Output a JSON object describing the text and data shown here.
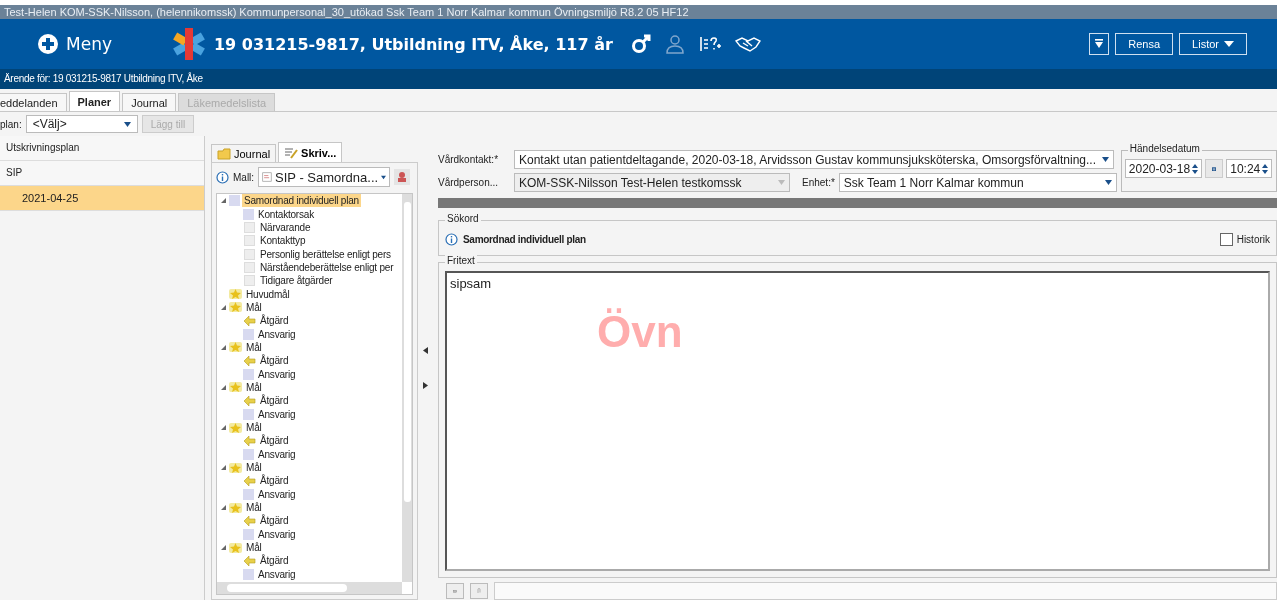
{
  "title_bar": {
    "title": "Test-Helen  KOM-SSK-Nilsson, (helennikomssk) Kommunpersonal_30_utökad Ssk Team 1 Norr Kalmar kommun Övningsmiljö R8.2 05 HF12"
  },
  "header": {
    "menu_label": "Meny",
    "patient": "19 031215-9817,  Utbildning ITV, Åke,  117 år",
    "buttons": [
      {
        "label": "Rensa",
        "kind": "plain"
      },
      {
        "label": "Listor",
        "kind": "dropdown"
      }
    ]
  },
  "case_bar": {
    "text": "Ärende för: 19 031215-9817 Utbildning ITV, Åke"
  },
  "tabs": [
    {
      "label": "eddelanden",
      "selected": false,
      "disabled": false
    },
    {
      "label": "Planer",
      "selected": true,
      "disabled": false
    },
    {
      "label": "Journal",
      "selected": false,
      "disabled": false
    },
    {
      "label": "Läkemedelslista",
      "selected": false,
      "disabled": true
    }
  ],
  "plan_toolbar": {
    "label": "plan:",
    "select": "<Välj>",
    "button": {
      "label": "Lägg till",
      "disabled": true
    }
  },
  "plan_list": [
    {
      "label": "Utskrivningsplan",
      "selected": false
    },
    {
      "label": "SIP",
      "selected": false,
      "children": [
        {
          "label": "2021-04-25",
          "selected": true
        }
      ]
    }
  ],
  "template_tabs": [
    {
      "label": "Journal",
      "selected": false
    },
    {
      "label": "Skriv...",
      "selected": true
    }
  ],
  "template": {
    "label": "Mall:",
    "value": "SIP - Samordna..."
  },
  "tree": [
    {
      "label": "Samordnad individuell plan",
      "kind": "section",
      "expanded": true,
      "selected": true,
      "children": [
        {
          "label": "Kontaktorsak",
          "kind": "section",
          "selected": false
        },
        {
          "label": "Närvarande",
          "kind": "field",
          "selected": false
        },
        {
          "label": "Kontakttyp",
          "kind": "field",
          "selected": false
        },
        {
          "label": "Personlig berättelse enligt pers",
          "kind": "field",
          "selected": false
        },
        {
          "label": "Närståendeberättelse enligt per",
          "kind": "field",
          "selected": false
        },
        {
          "label": "Tidigare åtgärder",
          "kind": "field",
          "selected": false
        }
      ]
    },
    {
      "label": "Huvudmål",
      "kind": "goal",
      "selected": false
    },
    {
      "label": "Mål",
      "kind": "goal",
      "expanded": true,
      "selected": false,
      "children": [
        {
          "label": "Åtgärd",
          "kind": "action",
          "selected": false
        },
        {
          "label": "Ansvarig",
          "kind": "section",
          "selected": false
        }
      ]
    },
    {
      "label": "Mål",
      "kind": "goal",
      "expanded": true,
      "selected": false,
      "children": [
        {
          "label": "Åtgärd",
          "kind": "action",
          "selected": false
        },
        {
          "label": "Ansvarig",
          "kind": "section",
          "selected": false
        }
      ]
    },
    {
      "label": "Mål",
      "kind": "goal",
      "expanded": true,
      "selected": false,
      "children": [
        {
          "label": "Åtgärd",
          "kind": "action",
          "selected": false
        },
        {
          "label": "Ansvarig",
          "kind": "section",
          "selected": false
        }
      ]
    },
    {
      "label": "Mål",
      "kind": "goal",
      "expanded": true,
      "selected": false,
      "children": [
        {
          "label": "Åtgärd",
          "kind": "action",
          "selected": false
        },
        {
          "label": "Ansvarig",
          "kind": "section",
          "selected": false
        }
      ]
    },
    {
      "label": "Mål",
      "kind": "goal",
      "expanded": true,
      "selected": false,
      "children": [
        {
          "label": "Åtgärd",
          "kind": "action",
          "selected": false
        },
        {
          "label": "Ansvarig",
          "kind": "section",
          "selected": false
        }
      ]
    },
    {
      "label": "Mål",
      "kind": "goal",
      "expanded": true,
      "selected": false,
      "children": [
        {
          "label": "Åtgärd",
          "kind": "action",
          "selected": false
        },
        {
          "label": "Ansvarig",
          "kind": "section",
          "selected": false
        }
      ]
    },
    {
      "label": "Mål",
      "kind": "goal",
      "expanded": true,
      "selected": false,
      "children": [
        {
          "label": "Åtgärd",
          "kind": "action",
          "selected": false
        },
        {
          "label": "Ansvarig",
          "kind": "section",
          "selected": false
        }
      ]
    }
  ],
  "form": {
    "contact": {
      "label": "Vårdkontakt:*",
      "value": "Kontakt utan patientdeltagande, 2020-03-18, Arvidsson Gustav kommunsjuksköterska, Omsorgsförvaltning..."
    },
    "person": {
      "label": "Vårdperson...",
      "value": "KOM-SSK-Nilsson Test-Helen testkomssk",
      "disabled": true
    },
    "unit": {
      "label": "Enhet:*",
      "value": "Ssk Team 1 Norr Kalmar kommun"
    },
    "event_date": {
      "legend": "Händelsedatum",
      "date": "2020-03-18",
      "time": "10:24"
    }
  },
  "keywords": {
    "legend": "Sökord",
    "heading": "Samordnad individuell plan",
    "history": {
      "label": "Historik",
      "checked": false
    }
  },
  "free_text": {
    "legend": "Fritext",
    "value": "sipsam",
    "environment_mark": "Övn"
  }
}
